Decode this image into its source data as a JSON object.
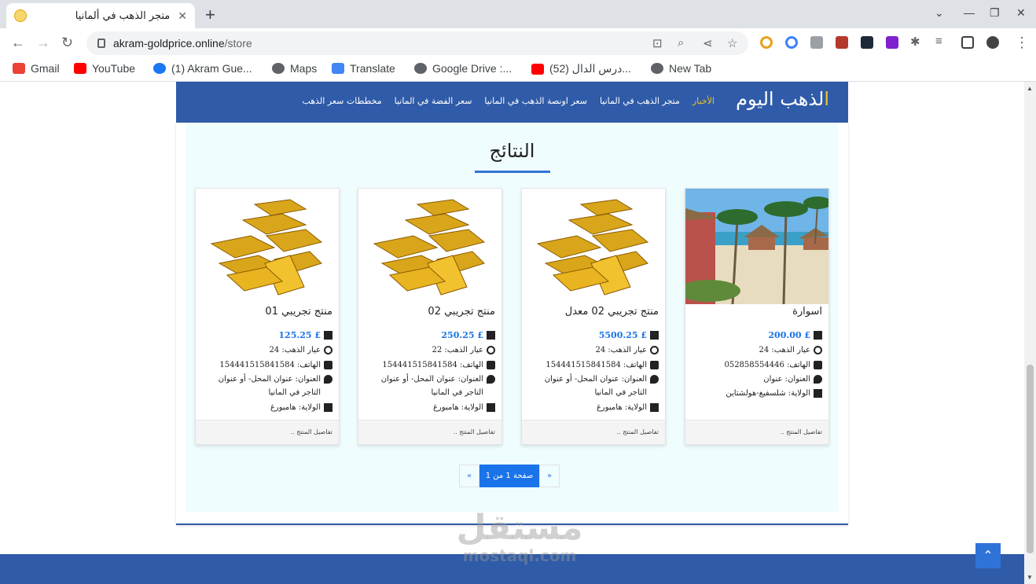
{
  "browser": {
    "tab_title": "متجر الذهب في ألمانيا",
    "url_host": "akram-goldprice.online",
    "url_path": "/store",
    "bookmarks": [
      "Gmail",
      "YouTube",
      "(1) Akram Gue...",
      "Maps",
      "Translate",
      "Google Drive :...",
      "(52) درس الدال...",
      "New Tab"
    ]
  },
  "site": {
    "brand_first": "ا",
    "brand_rest": "لذهب اليوم",
    "nav": [
      "الأخبار",
      "متجر الذهب في المانيا",
      "سعر اونصة الذهب في المانيا",
      "سعر الفضة في المانيا",
      "مخططات سعر الذهب"
    ]
  },
  "results": {
    "title": "النتائج",
    "cards": [
      {
        "name": "اسوارة",
        "price": "£ 200.00",
        "karat": "عيار الذهب: 24",
        "phone": "الهاتف: 052858554446",
        "address": "العنوان: عنوان",
        "state": "الولاية: شلسفيغ-هولشتاين",
        "details": "تفاصيل المنتج .."
      },
      {
        "name": "منتج تجريبي 02 معدل",
        "price": "£ 5500.25",
        "karat": "عيار الذهب: 24",
        "phone": "الهاتف: 154441515841584",
        "address": "العنوان: عنوان المحل- أو عنوان التاجر في المانيا",
        "state": "الولاية: هامبورغ",
        "details": "تفاصيل المنتج .."
      },
      {
        "name": "منتج تجريبي 02",
        "price": "£ 250.25",
        "karat": "عيار الذهب: 22",
        "phone": "الهاتف: 154441515841584",
        "address": "العنوان: عنوان المحل- أو عنوان التاجر في المانيا",
        "state": "الولاية: هامبورغ",
        "details": "تفاصيل المنتج .."
      },
      {
        "name": "منتج تجريبي 01",
        "price": "£ 125.25",
        "karat": "عيار الذهب: 24",
        "phone": "الهاتف: 154441515841584",
        "address": "العنوان: عنوان المحل- أو عنوان التاجر في المانيا",
        "state": "الولاية: هامبورغ",
        "details": "تفاصيل المنتج .."
      }
    ]
  },
  "pagination": {
    "prev": "«",
    "current": "صفحة 1 من 1",
    "next": "»"
  },
  "watermark": {
    "arabic": "مستقل",
    "latin": "mostaql.com"
  },
  "colors": {
    "nav": "#2f5ba8",
    "accent": "#1a73e8",
    "brand_gold": "#f3c623",
    "panel": "#f0fdff"
  }
}
